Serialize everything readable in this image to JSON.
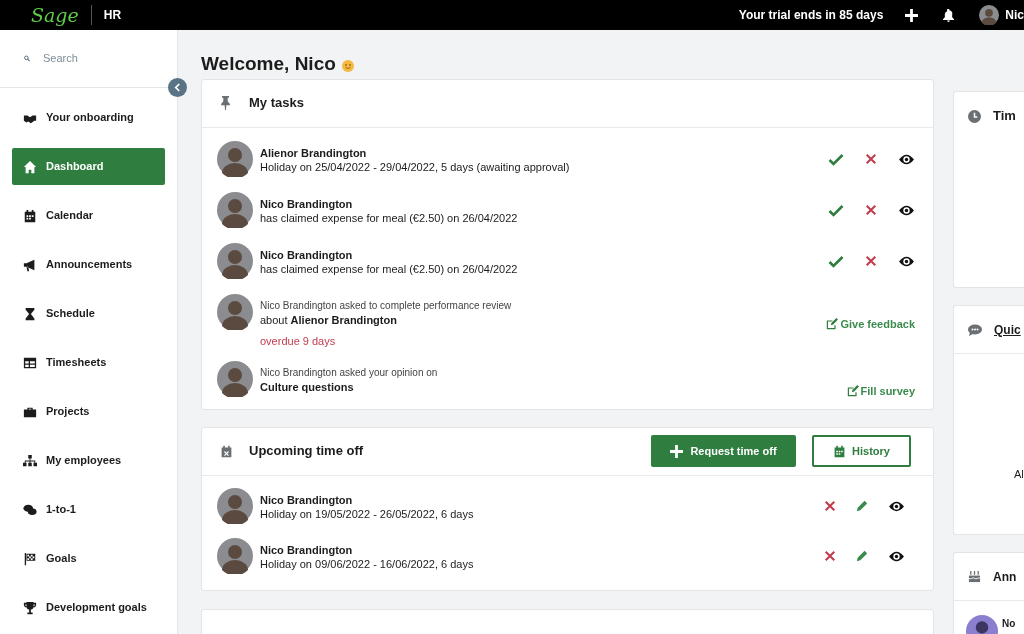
{
  "topbar": {
    "logo": "Sage",
    "product": "HR",
    "trial": "Your trial ends in 85 days",
    "user": "Nic"
  },
  "sidebar": {
    "search": {
      "placeholder": "Search"
    },
    "items": [
      {
        "label": "Your onboarding",
        "selected": false
      },
      {
        "label": "Dashboard",
        "selected": true
      },
      {
        "label": "Calendar",
        "selected": false
      },
      {
        "label": "Announcements",
        "selected": false
      },
      {
        "label": "Schedule",
        "selected": false
      },
      {
        "label": "Timesheets",
        "selected": false
      },
      {
        "label": "Projects",
        "selected": false
      },
      {
        "label": "My employees",
        "selected": false
      },
      {
        "label": "1-to-1",
        "selected": false
      },
      {
        "label": "Goals",
        "selected": false
      },
      {
        "label": "Development goals",
        "selected": false
      }
    ]
  },
  "heading": "Welcome, Nico",
  "tasks": {
    "title": "My tasks",
    "rows": [
      {
        "kind": "approval",
        "name": "Alienor Brandington",
        "text": "Holiday on 25/04/2022 - 29/04/2022, 5 days (awaiting approval)"
      },
      {
        "kind": "approval",
        "name": "Nico Brandington",
        "text": "has claimed expense for meal (€2.50) on 26/04/2022"
      },
      {
        "kind": "approval",
        "name": "Nico Brandington",
        "text": "has claimed expense for meal (€2.50) on 26/04/2022"
      },
      {
        "kind": "link",
        "line1": "Nico Brandington asked to complete performance review",
        "line2": "about **Alienor Brandington**",
        "note": "overdue 9 days",
        "action": "Give feedback"
      },
      {
        "kind": "link",
        "line1": "Nico Brandington asked your opinion on",
        "line2": "**Culture questions**",
        "action": "Fill survey"
      }
    ]
  },
  "time_off": {
    "title": "Upcoming time off",
    "request_button": "Request time off",
    "history_button": "History",
    "rows": [
      {
        "name": "Nico Brandington",
        "text": "Holiday on 19/05/2022 - 26/05/2022, 6 days"
      },
      {
        "name": "Nico Brandington",
        "text": "Holiday on 09/06/2022 - 16/06/2022, 6 days"
      }
    ]
  },
  "right_column": {
    "cards": [
      {
        "kind": "time",
        "title": "Tim"
      },
      {
        "kind": "quick",
        "title": "Quic",
        "body": "Al"
      },
      {
        "kind": "anniversary",
        "title": "Ann",
        "person": "No"
      }
    ]
  }
}
